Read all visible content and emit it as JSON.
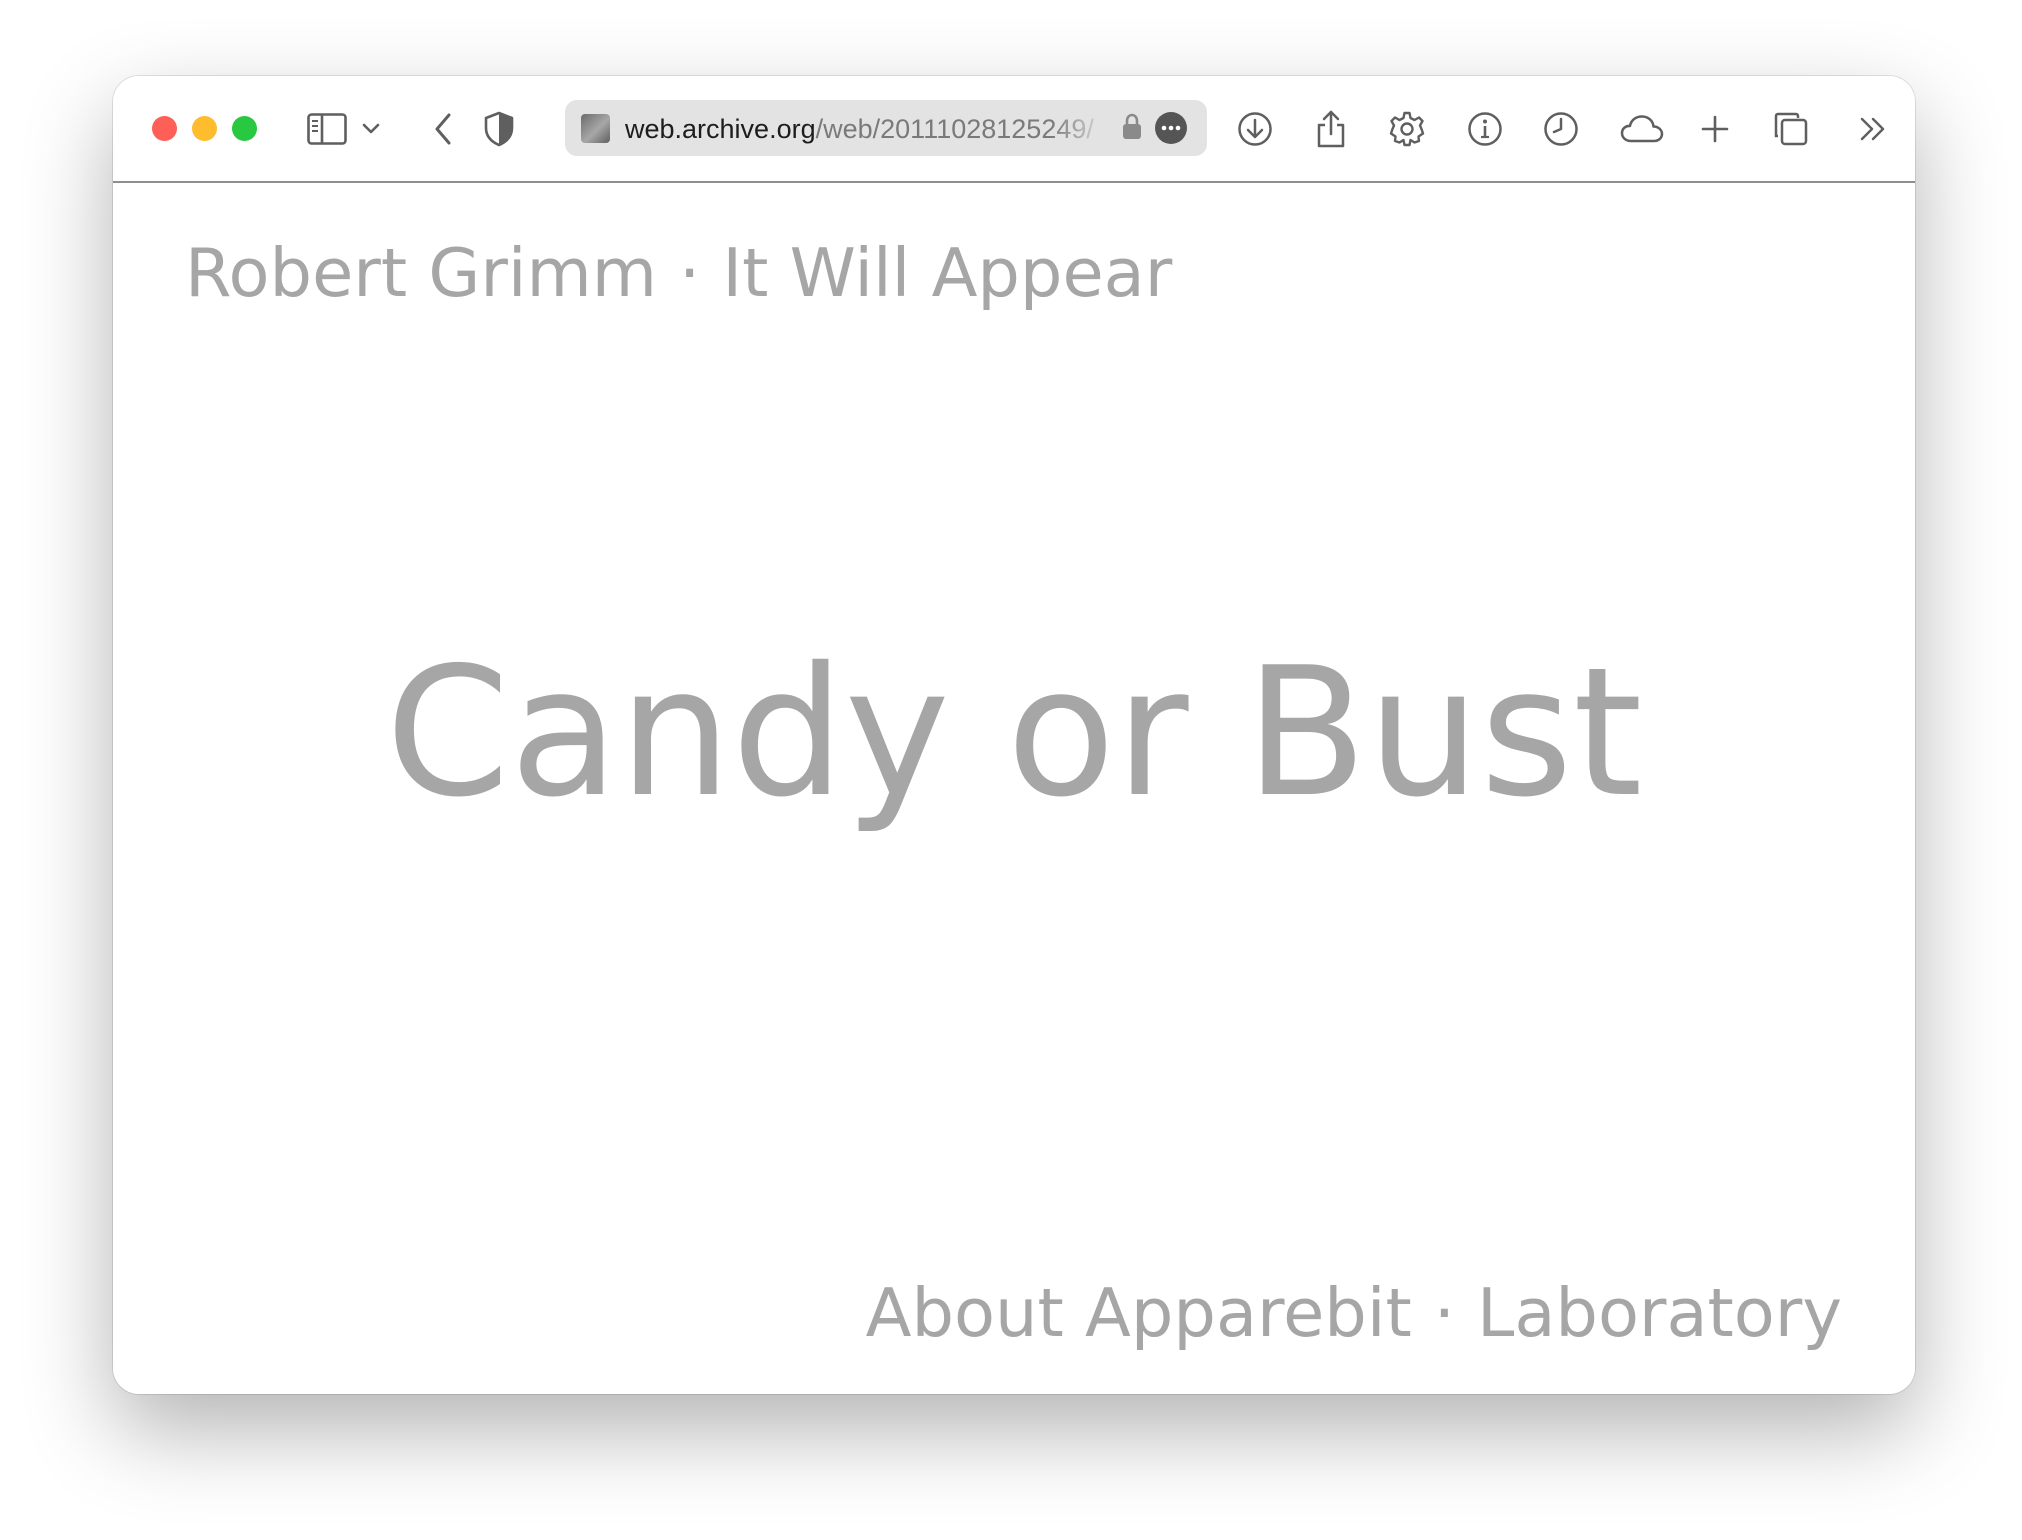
{
  "browser": {
    "url_domain": "web.archive.org",
    "url_path": "/web/20111028125249/",
    "toolbar_icons": [
      "sidebar-icon",
      "chevron-down-icon",
      "back-icon",
      "shield-icon",
      "download-icon",
      "share-icon",
      "gear-icon",
      "info-icon",
      "clock-icon",
      "cloud-icon",
      "plus-icon",
      "tabs-icon",
      "chevrons-right-icon"
    ],
    "traffic_lights": {
      "close": "#fe5f57",
      "minimize": "#febc2e",
      "zoom": "#28c840"
    }
  },
  "page": {
    "header": {
      "author": "Robert Grimm",
      "separator": "·",
      "site": "It Will Appear"
    },
    "title": "Candy or Bust",
    "footer": {
      "link1": "About Apparebit",
      "separator": "·",
      "link2": "Laboratory"
    },
    "text_color": "#a6a6a6"
  }
}
